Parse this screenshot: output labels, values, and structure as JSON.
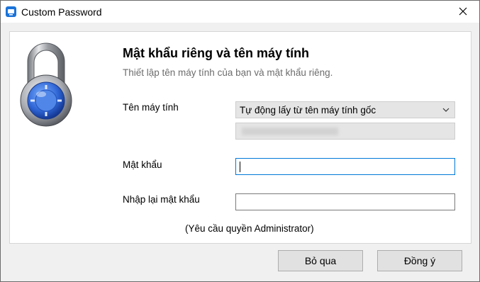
{
  "window": {
    "title": "Custom Password"
  },
  "header": {
    "heading": "Mật khẩu riêng và tên máy tính",
    "subheading": "Thiết lập tên máy tính của bạn và mật khẩu riêng."
  },
  "form": {
    "computer_name_label": "Tên máy tính",
    "computer_name_selected": "Tự động lấy từ tên máy tính gốc",
    "password_label": "Mật khẩu",
    "password_value": "",
    "confirm_label": "Nhập lại mật khẩu",
    "confirm_value": "",
    "note": "(Yêu cầu quyền Administrator)"
  },
  "buttons": {
    "skip_label": "Bỏ qua",
    "ok_label": "Đồng ý"
  },
  "icons": {
    "app": "app-icon",
    "close": "close-icon",
    "lock": "padlock-icon",
    "dropdown": "chevron-down-icon"
  },
  "colors": {
    "accent": "#0078d7",
    "lock_dial": "#3a6fd8"
  }
}
